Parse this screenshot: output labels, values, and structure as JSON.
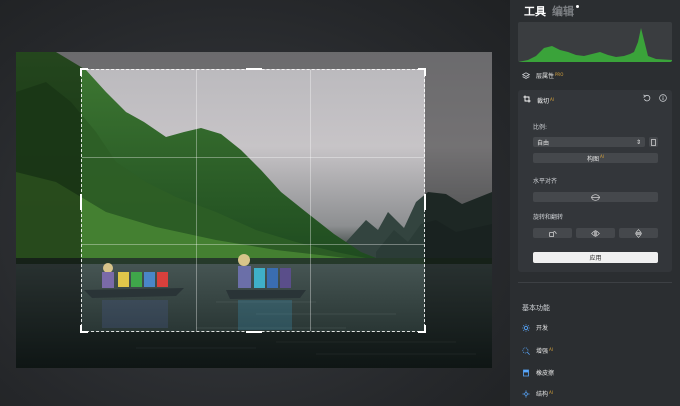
{
  "tabs": {
    "tools": "工具",
    "edit": "编辑"
  },
  "panel": {
    "layer_properties": {
      "label": "层属性",
      "badge": "PRO"
    },
    "crop": {
      "title": "裁切",
      "badge": "AI",
      "ratio_label": "比例:",
      "ratio_value": "自由",
      "composition_label": "构图",
      "composition_badge": "AI",
      "level_label": "水平对齐",
      "rotate_label": "旋转和翻转",
      "apply_label": "应用"
    },
    "basic_section": "基本功能",
    "features": [
      {
        "label": "开发",
        "badge": ""
      },
      {
        "label": "增强",
        "badge": "AI"
      },
      {
        "label": "橡皮擦",
        "badge": ""
      },
      {
        "label": "结构",
        "badge": "AI"
      }
    ]
  },
  "colors": {
    "accent_blue": "#58a8ff",
    "badge_gold": "#d6a23c",
    "histogram_green": "#3aa33a",
    "panel_bg": "#2b2e31",
    "card_bg": "#33363a"
  },
  "icons": {
    "layers": "layers-icon",
    "crop": "crop-icon",
    "reset": "undo-icon",
    "info": "info-icon",
    "rotate": "rotate-icon",
    "flip_h": "flip-horizontal-icon",
    "flip_v": "flip-vertical-icon"
  }
}
